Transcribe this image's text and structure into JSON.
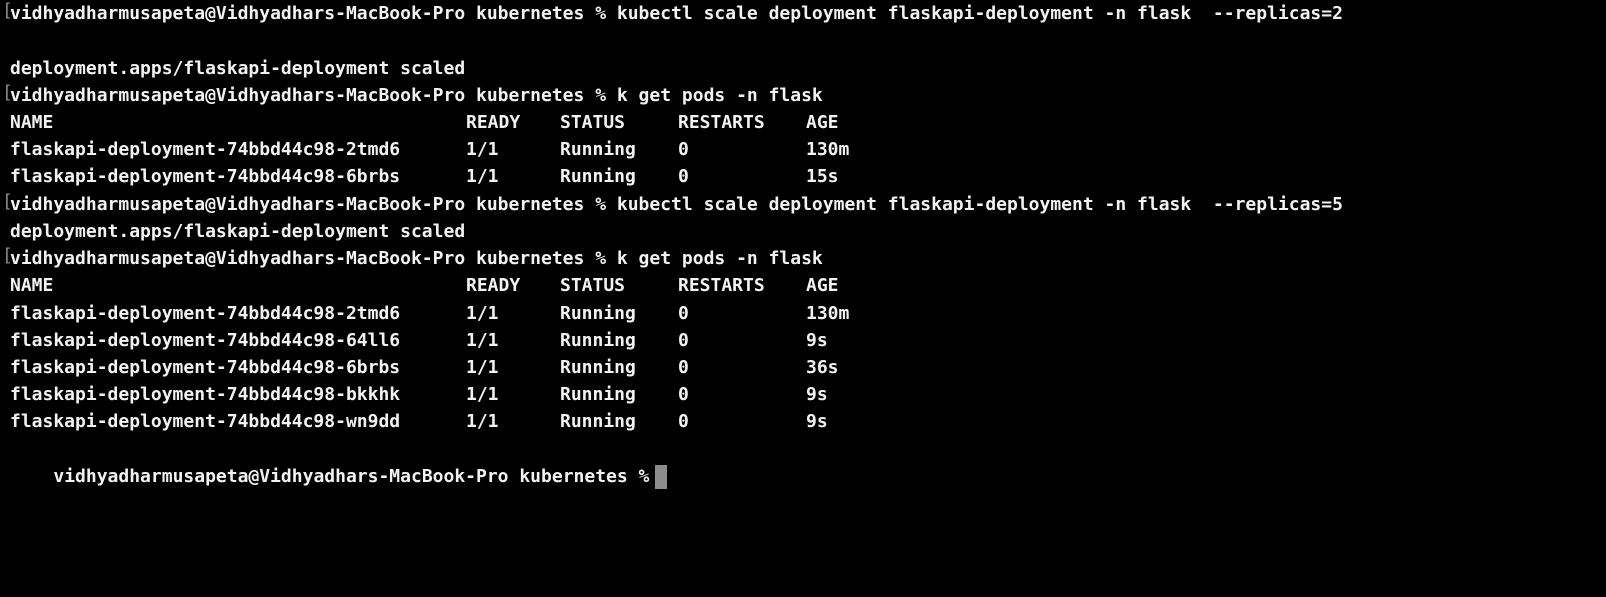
{
  "colors": {
    "background": "#000000",
    "foreground": "#f2f2f2",
    "cursor": "#8c8c8c",
    "prompt_marker": "#8a8a8a"
  },
  "prompt_marker": "[",
  "lines": {
    "cmd1": "vidhyadharmusapeta@Vidhyadhars-MacBook-Pro kubernetes % kubectl scale deployment flaskapi-deployment -n flask  --replicas=2",
    "out1": "deployment.apps/flaskapi-deployment scaled",
    "cmd2": "vidhyadharmusapeta@Vidhyadhars-MacBook-Pro kubernetes % k get pods -n flask",
    "cmd3": "vidhyadharmusapeta@Vidhyadhars-MacBook-Pro kubernetes % kubectl scale deployment flaskapi-deployment -n flask  --replicas=5",
    "out3": "deployment.apps/flaskapi-deployment scaled",
    "cmd4": "vidhyadharmusapeta@Vidhyadhars-MacBook-Pro kubernetes % k get pods -n flask",
    "prompt_final": "vidhyadharmusapeta@Vidhyadhars-MacBook-Pro kubernetes %"
  },
  "pods_table_1": {
    "headers": [
      "NAME",
      "READY",
      "STATUS",
      "RESTARTS",
      "AGE"
    ],
    "rows": [
      [
        "flaskapi-deployment-74bbd44c98-2tmd6",
        "1/1",
        "Running",
        "0",
        "130m"
      ],
      [
        "flaskapi-deployment-74bbd44c98-6brbs",
        "1/1",
        "Running",
        "0",
        "15s"
      ]
    ]
  },
  "pods_table_2": {
    "headers": [
      "NAME",
      "READY",
      "STATUS",
      "RESTARTS",
      "AGE"
    ],
    "rows": [
      [
        "flaskapi-deployment-74bbd44c98-2tmd6",
        "1/1",
        "Running",
        "0",
        "130m"
      ],
      [
        "flaskapi-deployment-74bbd44c98-64ll6",
        "1/1",
        "Running",
        "0",
        "9s"
      ],
      [
        "flaskapi-deployment-74bbd44c98-6brbs",
        "1/1",
        "Running",
        "0",
        "36s"
      ],
      [
        "flaskapi-deployment-74bbd44c98-bkkhk",
        "1/1",
        "Running",
        "0",
        "9s"
      ],
      [
        "flaskapi-deployment-74bbd44c98-wn9dd",
        "1/1",
        "Running",
        "0",
        "9s"
      ]
    ]
  }
}
